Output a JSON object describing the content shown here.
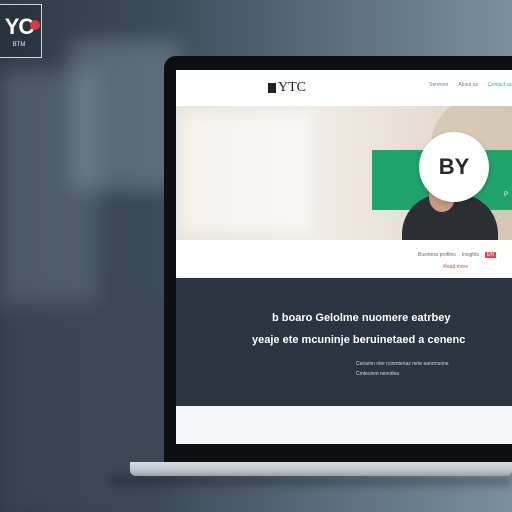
{
  "corner_badge": {
    "logo_text": "YC",
    "sub_text": "BTM"
  },
  "site": {
    "logo_text": "YTC",
    "nav": [
      {
        "label": "Services"
      },
      {
        "label": "About us"
      },
      {
        "label": "Contact us"
      }
    ],
    "hero": {
      "circle_text": "BY",
      "side_text": "P"
    },
    "meta": {
      "items": [
        "Business profiles",
        "Insights"
      ],
      "badge": "EN",
      "sub": "Read more"
    },
    "dark": {
      "line1": "b boaro Gelolme nuomere eatrbey",
      "line2": "yeaje ete mcuninje beruinetaed a cenenc",
      "small1": "Ceiramn oter rcinmtenaz mrte eanrmsone",
      "small2": "Cmtecinm nenntlea"
    }
  },
  "colors": {
    "accent_green": "#1fa56b",
    "dark_section": "#2c3440",
    "badge_red": "#e44848"
  }
}
